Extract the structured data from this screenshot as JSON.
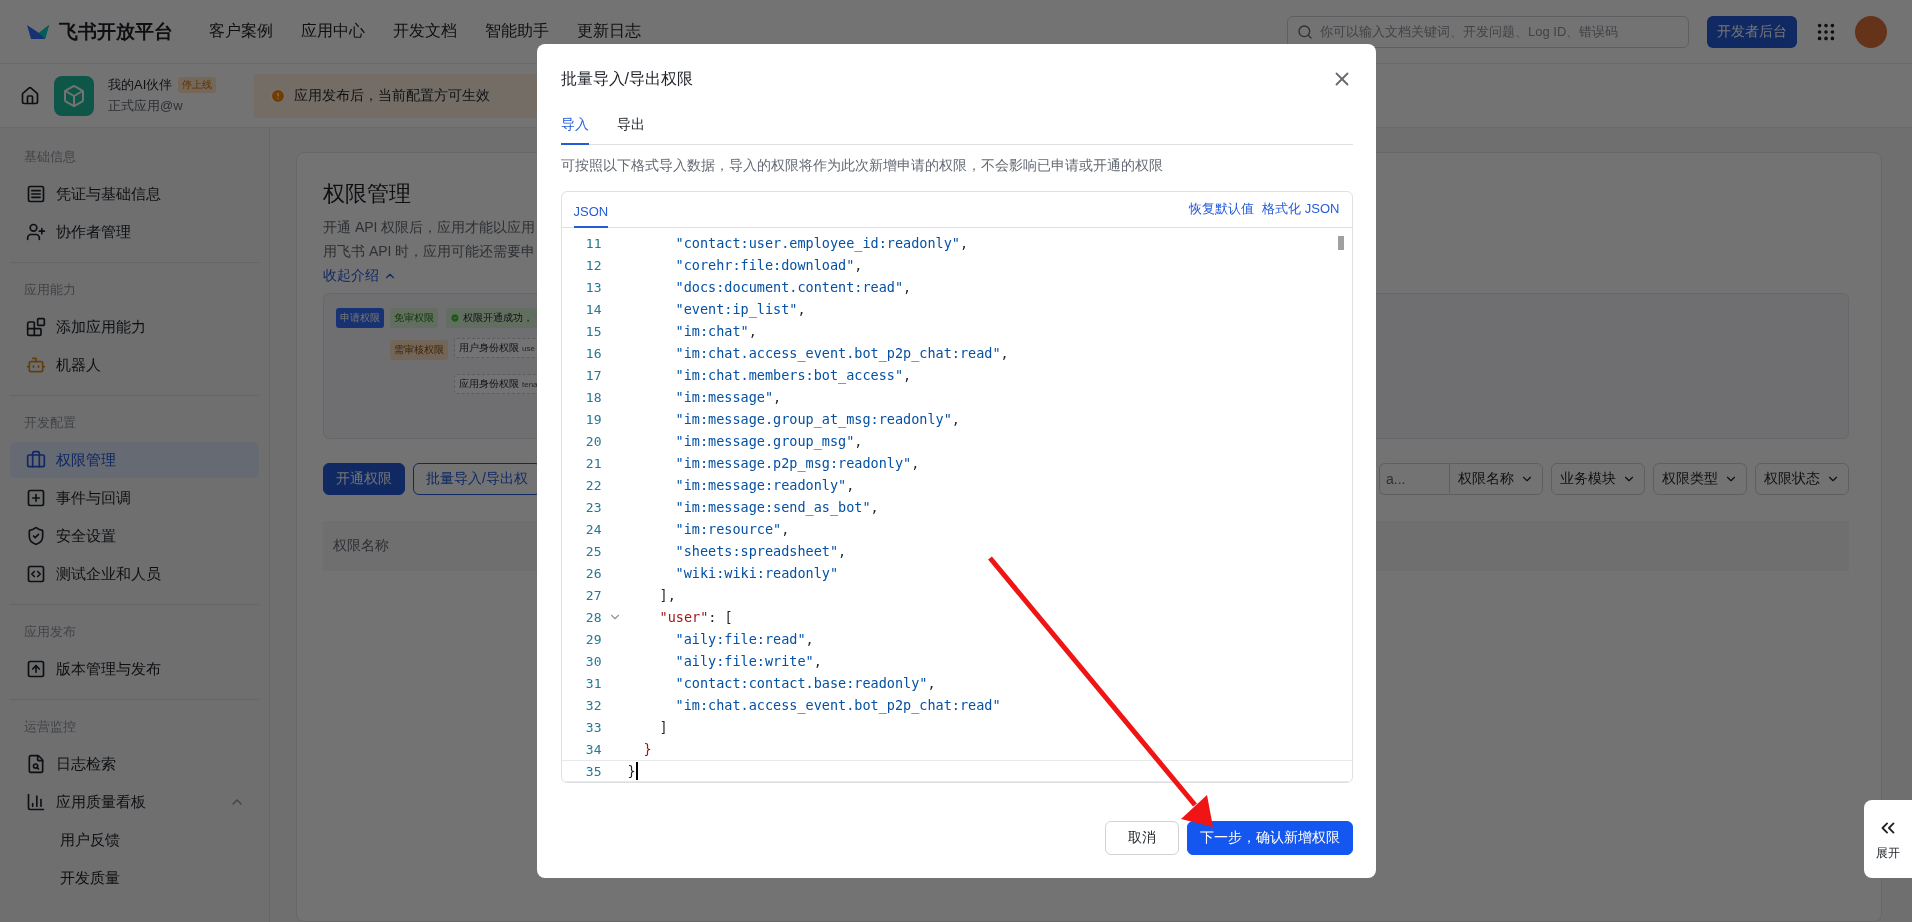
{
  "topbar": {
    "logo": "飞书开放平台",
    "nav": [
      "客户案例",
      "应用中心",
      "开发文档",
      "智能助手",
      "更新日志"
    ],
    "search": {
      "placeholder": "你可以输入文档关键词、开发问题、Log ID、错误码"
    },
    "console_button": "开发者后台"
  },
  "app_bar": {
    "app_name": "我的AI伙伴",
    "badge": "停上线",
    "app_subtitle": "正式应用@w",
    "notice": "应用发布后，当前配置方可生效"
  },
  "sidebar": {
    "sections": [
      {
        "title": "基础信息",
        "items": [
          {
            "label": "凭证与基础信息",
            "selected": false
          },
          {
            "label": "协作者管理",
            "selected": false
          }
        ]
      },
      {
        "title": "应用能力",
        "items": [
          {
            "label": "添加应用能力",
            "selected": false
          },
          {
            "label": "机器人",
            "selected": false
          }
        ]
      },
      {
        "title": "开发配置",
        "items": [
          {
            "label": "权限管理",
            "selected": true
          },
          {
            "label": "事件与回调",
            "selected": false
          },
          {
            "label": "安全设置",
            "selected": false
          },
          {
            "label": "测试企业和人员",
            "selected": false
          }
        ]
      },
      {
        "title": "应用发布",
        "items": [
          {
            "label": "版本管理与发布",
            "selected": false
          }
        ]
      },
      {
        "title": "运营监控",
        "items": [
          {
            "label": "日志检索",
            "selected": false
          },
          {
            "label": "应用质量看板",
            "selected": false,
            "expanded": true,
            "children": [
              {
                "label": "用户反馈",
                "selected": false
              },
              {
                "label": "开发质量",
                "selected": false
              }
            ]
          }
        ]
      }
    ]
  },
  "page": {
    "title": "权限管理",
    "description": [
      "开通 API 权限后，应用才能以应用",
      "用飞书 API 时，应用可能还需要申"
    ],
    "collapse_link": "收起介绍",
    "diagram": {
      "nodes": [
        {
          "kind": "primary",
          "label": "申请权限"
        },
        {
          "kind": "free",
          "label": "免审权限"
        },
        {
          "kind": "success",
          "label": "权限开通成功，"
        },
        {
          "kind": "review",
          "label": "需审核权限"
        },
        {
          "kind": "outline",
          "label": "用户身份权限",
          "note": "use"
        },
        {
          "kind": "outline",
          "label": "应用身份权限",
          "note": "tena"
        }
      ]
    },
    "buttons": [
      {
        "kind": "primary",
        "label": "开通权限"
      },
      {
        "kind": "outline",
        "label": "批量导入/导出权"
      }
    ],
    "search": {
      "placeholder": "a..."
    },
    "filters": [
      "权限名称",
      "业务模块",
      "权限类型",
      "权限状态"
    ],
    "table": {
      "columns": [
        "权限名称"
      ]
    }
  },
  "side_tab": {
    "label": "展开"
  },
  "dialog": {
    "title": "批量导入/导出权限",
    "tabs": [
      {
        "label": "导入",
        "selected": true
      },
      {
        "label": "导出",
        "selected": false
      }
    ],
    "description": "可按照以下格式导入数据，导入的权限将作为此次新增申请的权限，不会影响已申请或开通的权限",
    "editor": {
      "tabs": [
        {
          "label": "JSON",
          "selected": true
        }
      ],
      "actions": [
        "恢复默认值",
        "格式化 JSON"
      ],
      "lines": [
        {
          "no": "11",
          "kind": "item",
          "active": false,
          "segments": [
            {
              "kind": "string",
              "text": "\"contact:user.employee_id:readonly\""
            },
            {
              "kind": "plain",
              "text": ","
            }
          ]
        },
        {
          "no": "12",
          "kind": "item",
          "active": false,
          "segments": [
            {
              "kind": "string",
              "text": "\"corehr:file:download\""
            },
            {
              "kind": "plain",
              "text": ","
            }
          ]
        },
        {
          "no": "13",
          "kind": "item",
          "active": false,
          "segments": [
            {
              "kind": "string",
              "text": "\"docs:document.content:read\""
            },
            {
              "kind": "plain",
              "text": ","
            }
          ]
        },
        {
          "no": "14",
          "kind": "item",
          "active": false,
          "segments": [
            {
              "kind": "string",
              "text": "\"event:ip_list\""
            },
            {
              "kind": "plain",
              "text": ","
            }
          ]
        },
        {
          "no": "15",
          "kind": "item",
          "active": false,
          "segments": [
            {
              "kind": "string",
              "text": "\"im:chat\""
            },
            {
              "kind": "plain",
              "text": ","
            }
          ]
        },
        {
          "no": "16",
          "kind": "item",
          "active": false,
          "segments": [
            {
              "kind": "string",
              "text": "\"im:chat.access_event.bot_p2p_chat:read\""
            },
            {
              "kind": "plain",
              "text": ","
            }
          ]
        },
        {
          "no": "17",
          "kind": "item",
          "active": false,
          "segments": [
            {
              "kind": "string",
              "text": "\"im:chat.members:bot_access\""
            },
            {
              "kind": "plain",
              "text": ","
            }
          ]
        },
        {
          "no": "18",
          "kind": "item",
          "active": false,
          "segments": [
            {
              "kind": "string",
              "text": "\"im:message\""
            },
            {
              "kind": "plain",
              "text": ","
            }
          ]
        },
        {
          "no": "19",
          "kind": "item",
          "active": false,
          "segments": [
            {
              "kind": "string",
              "text": "\"im:message.group_at_msg:readonly\""
            },
            {
              "kind": "plain",
              "text": ","
            }
          ]
        },
        {
          "no": "20",
          "kind": "item",
          "active": false,
          "segments": [
            {
              "kind": "string",
              "text": "\"im:message.group_msg\""
            },
            {
              "kind": "plain",
              "text": ","
            }
          ]
        },
        {
          "no": "21",
          "kind": "item",
          "active": false,
          "segments": [
            {
              "kind": "string",
              "text": "\"im:message.p2p_msg:readonly\""
            },
            {
              "kind": "plain",
              "text": ","
            }
          ]
        },
        {
          "no": "22",
          "kind": "item",
          "active": false,
          "segments": [
            {
              "kind": "string",
              "text": "\"im:message:readonly\""
            },
            {
              "kind": "plain",
              "text": ","
            }
          ]
        },
        {
          "no": "23",
          "kind": "item",
          "active": false,
          "segments": [
            {
              "kind": "string",
              "text": "\"im:message:send_as_bot\""
            },
            {
              "kind": "plain",
              "text": ","
            }
          ]
        },
        {
          "no": "24",
          "kind": "item",
          "active": false,
          "segments": [
            {
              "kind": "string",
              "text": "\"im:resource\""
            },
            {
              "kind": "plain",
              "text": ","
            }
          ]
        },
        {
          "no": "25",
          "kind": "item",
          "active": false,
          "segments": [
            {
              "kind": "string",
              "text": "\"sheets:spreadsheet\""
            },
            {
              "kind": "plain",
              "text": ","
            }
          ]
        },
        {
          "no": "26",
          "kind": "item",
          "active": false,
          "segments": [
            {
              "kind": "string",
              "text": "\"wiki:wiki:readonly\""
            }
          ]
        },
        {
          "no": "27",
          "kind": "member",
          "active": false,
          "segments": [
            {
              "kind": "plain",
              "text": "],"
            }
          ]
        },
        {
          "no": "28",
          "kind": "member",
          "active": false,
          "expanded": true,
          "segments": [
            {
              "kind": "key",
              "text": "\"user\""
            },
            {
              "kind": "plain",
              "text": ": ["
            }
          ]
        },
        {
          "no": "29",
          "kind": "item",
          "active": false,
          "segments": [
            {
              "kind": "string",
              "text": "\"aily:file:read\""
            },
            {
              "kind": "plain",
              "text": ","
            }
          ]
        },
        {
          "no": "30",
          "kind": "item",
          "active": false,
          "segments": [
            {
              "kind": "string",
              "text": "\"aily:file:write\""
            },
            {
              "kind": "plain",
              "text": ","
            }
          ]
        },
        {
          "no": "31",
          "kind": "item",
          "active": false,
          "segments": [
            {
              "kind": "string",
              "text": "\"contact:contact.base:readonly\""
            },
            {
              "kind": "plain",
              "text": ","
            }
          ]
        },
        {
          "no": "32",
          "kind": "item",
          "active": false,
          "segments": [
            {
              "kind": "string",
              "text": "\"im:chat.access_event.bot_p2p_chat:read\""
            }
          ]
        },
        {
          "no": "33",
          "kind": "member",
          "active": false,
          "segments": [
            {
              "kind": "plain",
              "text": "]"
            }
          ]
        },
        {
          "no": "34",
          "kind": "object",
          "active": false,
          "segments": [
            {
              "kind": "key",
              "text": "}"
            }
          ]
        },
        {
          "no": "35",
          "kind": "root",
          "active": true,
          "segments": [
            {
              "kind": "plain",
              "text": "}"
            }
          ]
        }
      ]
    },
    "buttons": [
      {
        "kind": "secondary",
        "label": "取消"
      },
      {
        "kind": "primary",
        "label": "下一步，确认新增权限"
      }
    ]
  }
}
